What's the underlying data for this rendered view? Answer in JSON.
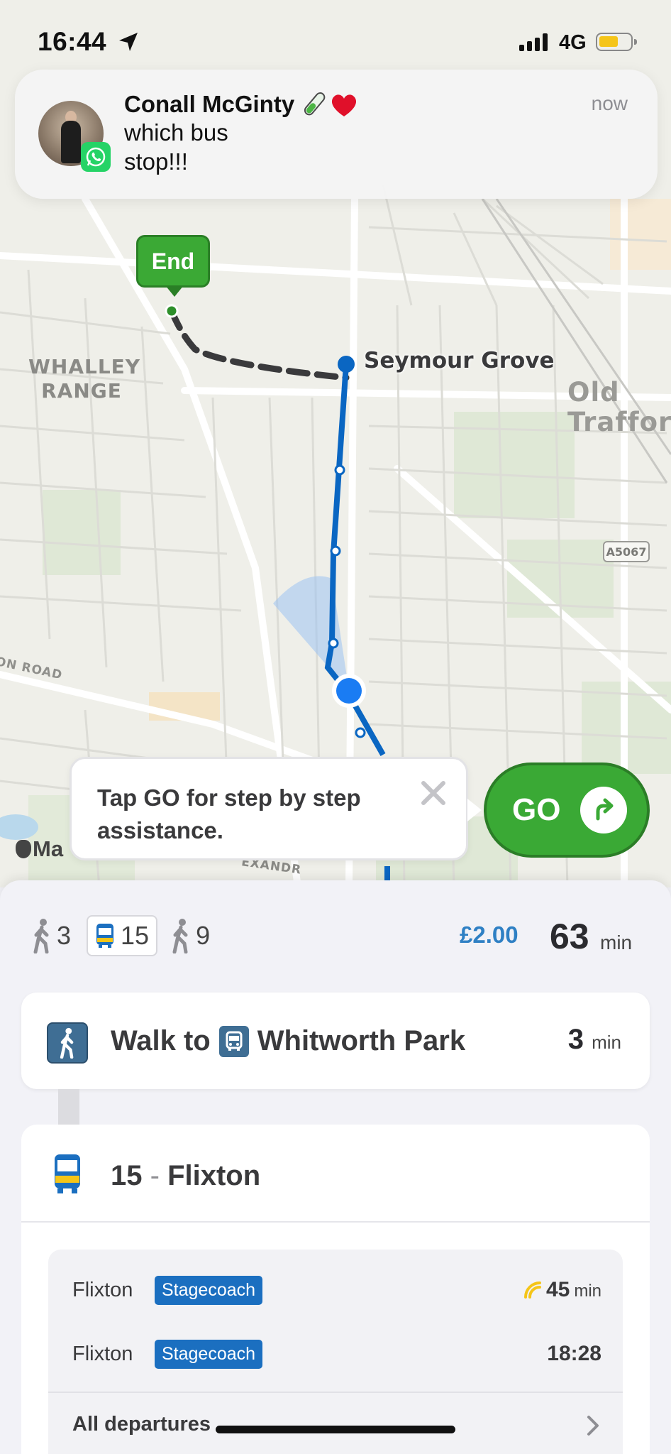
{
  "status_bar": {
    "time": "16:44",
    "network": "4G"
  },
  "notification": {
    "sender": "Conall McGinty",
    "sender_emoji": "🧪❤️",
    "message": "which bus stop!!!",
    "time": "now",
    "app_icon": "whatsapp-icon"
  },
  "map": {
    "area_labels": {
      "whalley_range": "WHALLEY RANGE",
      "old_trafford": "Old Trafford",
      "road_fragment": "ON ROAD",
      "road_fragment_2": "EXANDR"
    },
    "road_shield": "A5067",
    "stop_label": "Seymour Grove",
    "end_marker": "End",
    "attribution": "Ma"
  },
  "tooltip": {
    "text": "Tap GO for step by step assistance."
  },
  "go_button": {
    "label": "GO",
    "color": "#3aa935"
  },
  "summary": {
    "walk_start_min": "3",
    "bus_route": "15",
    "walk_end_min": "9",
    "fare": "£2.00",
    "duration": "63",
    "duration_unit": "min"
  },
  "walk_step": {
    "prefix": "Walk to",
    "stop_name": "Whitworth Park",
    "duration": "3",
    "unit": "min"
  },
  "bus_step": {
    "route": "15",
    "separator": "-",
    "destination": "Flixton",
    "departures": [
      {
        "destination": "Flixton",
        "operator": "Stagecoach",
        "time": "45",
        "unit": "min",
        "realtime": true
      },
      {
        "destination": "Flixton",
        "operator": "Stagecoach",
        "time": "18:28",
        "unit": "",
        "realtime": false
      }
    ],
    "all_departures_label": "All departures"
  },
  "colors": {
    "route_blue": "#0a66c2",
    "go_green": "#3aa935",
    "fare_blue": "#2f80c4",
    "operator_blue": "#1b6fc0"
  }
}
